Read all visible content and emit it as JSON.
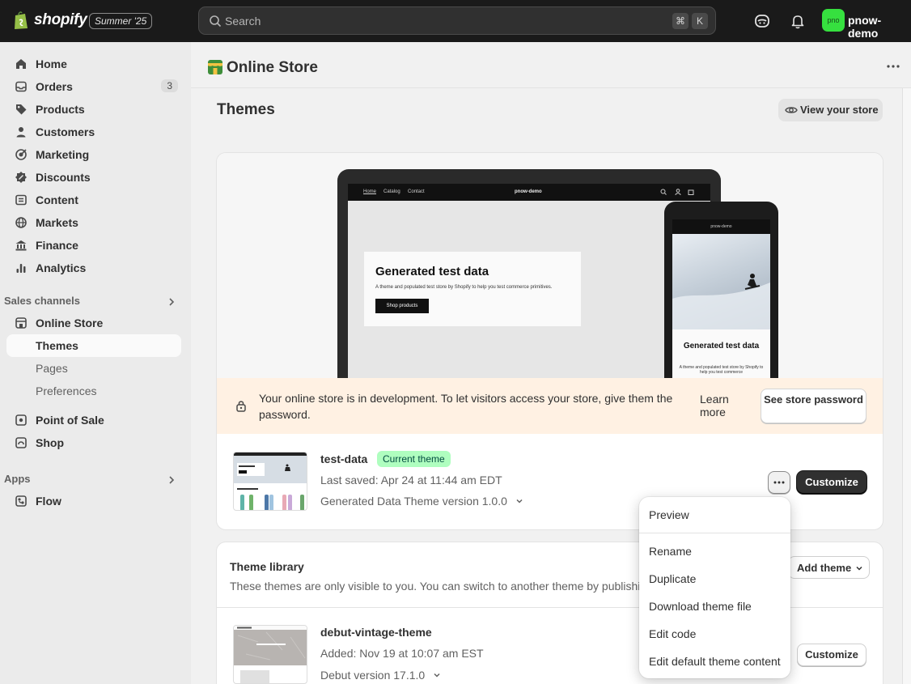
{
  "topbar": {
    "logo_text": "shopify",
    "edition": "Summer '25",
    "search_placeholder": "Search",
    "shortcut_key1": "⌘",
    "shortcut_key2": "K",
    "avatar_initials": "pno",
    "store_name": "pnow-demo"
  },
  "sidebar": {
    "items": [
      {
        "label": "Home",
        "icon": "home-icon"
      },
      {
        "label": "Orders",
        "icon": "orders-icon",
        "count": "3"
      },
      {
        "label": "Products",
        "icon": "tag-icon"
      },
      {
        "label": "Customers",
        "icon": "person-icon"
      },
      {
        "label": "Marketing",
        "icon": "target-icon"
      },
      {
        "label": "Discounts",
        "icon": "discount-icon"
      },
      {
        "label": "Content",
        "icon": "content-icon"
      },
      {
        "label": "Markets",
        "icon": "globe-icon"
      },
      {
        "label": "Finance",
        "icon": "bank-icon"
      },
      {
        "label": "Analytics",
        "icon": "bar-chart-icon"
      }
    ],
    "sales_channels_label": "Sales channels",
    "online_store_label": "Online Store",
    "sub_items": [
      "Themes",
      "Pages",
      "Preferences"
    ],
    "pos_label": "Point of Sale",
    "shop_label": "Shop",
    "apps_label": "Apps",
    "flow_label": "Flow"
  },
  "main": {
    "header_title": "Online Store",
    "themes_title": "Themes",
    "view_store_label": "View your store",
    "preview": {
      "laptop_nav": [
        "Home",
        "Catalog",
        "Contact"
      ],
      "laptop_store": "pnow-demo",
      "hero_title": "Generated test data",
      "hero_sub": "A theme and populated test store by Shopify to help you test commerce primitives.",
      "hero_button": "Shop products",
      "phone_store": "pnow-demo",
      "phone_title": "Generated test data",
      "phone_sub": "A theme and populated test store by Shopify to help you test commerce"
    },
    "dev_banner": {
      "text": "Your online store is in development. To let visitors access your store, give them the password.",
      "learn_more": "Learn more",
      "see_password": "See store password"
    },
    "current_theme": {
      "name": "test-data",
      "badge": "Current theme",
      "last_saved": "Last saved: Apr 24 at 11:44 am EDT",
      "version": "Generated Data Theme version 1.0.0",
      "customize_label": "Customize"
    },
    "library": {
      "title": "Theme library",
      "subtitle": "These themes are only visible to you. You can switch to another theme by publishi",
      "add_theme_label": "Add theme",
      "themes": [
        {
          "name": "debut-vintage-theme",
          "added": "Added: Nov 19 at 10:07 am EST",
          "version": "Debut version 17.1.0",
          "customize_label": "Customize"
        }
      ]
    }
  },
  "menu": {
    "items": [
      "Preview",
      "Rename",
      "Duplicate",
      "Download theme file",
      "Edit code",
      "Edit default theme content"
    ]
  },
  "colors": {
    "topbar_bg": "#1a1a1a",
    "sidebar_bg": "#ebebeb",
    "badge_green": "#affebf",
    "banner_orange": "#fff1e3",
    "avatar_green": "#36e03f"
  }
}
